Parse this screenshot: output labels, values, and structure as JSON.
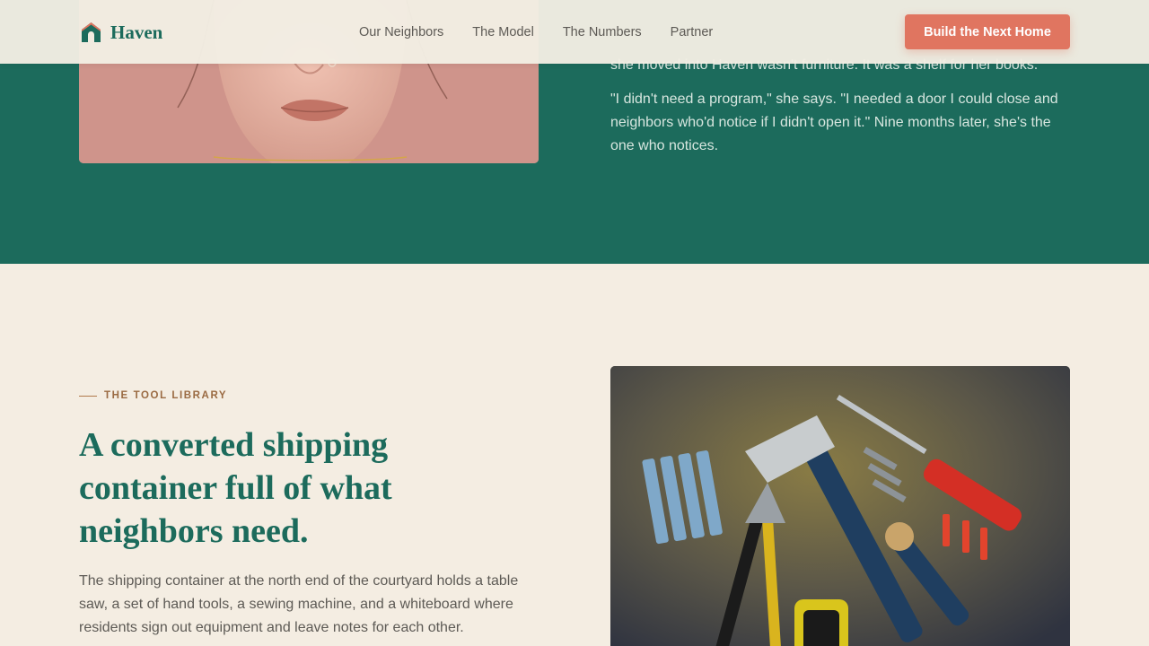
{
  "brand": {
    "name": "Haven",
    "accent": "#1c6b5c",
    "cta_color": "#e07560"
  },
  "nav": {
    "items": [
      {
        "label": "Our Neighbors"
      },
      {
        "label": "The Model"
      },
      {
        "label": "The Numbers"
      },
      {
        "label": "Partner"
      }
    ],
    "cta_label": "Build the Next Home"
  },
  "story": {
    "cut_line": "she moved into Haven wasn't furniture. It was a shelf for her books.",
    "quote": "\"I didn't need a program,\" she says. \"I needed a door I could close and neighbors who'd notice if I didn't open it.\" Nine months later, she's the one who notices.",
    "image": "portrait-photo"
  },
  "tools": {
    "eyebrow": "THE TOOL LIBRARY",
    "title": "A converted shipping container full of what neighbors need.",
    "body": "The shipping container at the north end of the courtyard holds a table saw, a set of hand tools, a sewing machine, and a whiteboard where residents sign out equipment and leave notes for each other.",
    "image": "tools-photo"
  }
}
